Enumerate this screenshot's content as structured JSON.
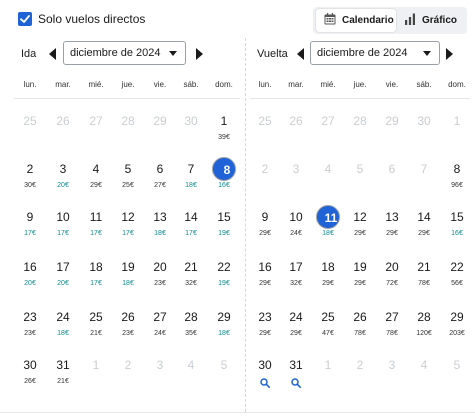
{
  "filters": {
    "direct_label": "Solo vuelos directos",
    "direct_checked": true
  },
  "view_toggle": {
    "calendar_label": "Calendario",
    "chart_label": "Gráfico",
    "active": "Calendario"
  },
  "outbound": {
    "label": "Ida",
    "month": "diciembre de 2024"
  },
  "return": {
    "label": "Vuelta",
    "month": "diciembre de 2024"
  },
  "weekdays": [
    "lun.",
    "mar.",
    "mié.",
    "jue.",
    "vie.",
    "sáb.",
    "dom."
  ],
  "outbound_weeks": [
    [
      {
        "d": "25",
        "out": true
      },
      {
        "d": "26",
        "out": true
      },
      {
        "d": "27",
        "out": true
      },
      {
        "d": "28",
        "out": true
      },
      {
        "d": "29",
        "out": true
      },
      {
        "d": "30",
        "out": true
      },
      {
        "d": "1",
        "p": "39€"
      }
    ],
    [
      {
        "d": "2",
        "p": "30€"
      },
      {
        "d": "3",
        "p": "20€",
        "g": true
      },
      {
        "d": "4",
        "p": "29€"
      },
      {
        "d": "5",
        "p": "25€"
      },
      {
        "d": "6",
        "p": "27€"
      },
      {
        "d": "7",
        "p": "18€",
        "g": true
      },
      {
        "d": "8",
        "p": "16€",
        "g": true,
        "sel": true
      }
    ],
    [
      {
        "d": "9",
        "p": "17€",
        "g": true
      },
      {
        "d": "10",
        "p": "17€",
        "g": true
      },
      {
        "d": "11",
        "p": "17€",
        "g": true
      },
      {
        "d": "12",
        "p": "17€",
        "g": true
      },
      {
        "d": "13",
        "p": "18€",
        "g": true
      },
      {
        "d": "14",
        "p": "17€",
        "g": true
      },
      {
        "d": "15",
        "p": "19€",
        "g": true
      }
    ],
    [
      {
        "d": "16",
        "p": "20€",
        "g": true
      },
      {
        "d": "17",
        "p": "20€",
        "g": true
      },
      {
        "d": "18",
        "p": "17€",
        "g": true
      },
      {
        "d": "19",
        "p": "18€",
        "g": true
      },
      {
        "d": "20",
        "p": "23€"
      },
      {
        "d": "21",
        "p": "32€"
      },
      {
        "d": "22",
        "p": "19€",
        "g": true
      }
    ],
    [
      {
        "d": "23",
        "p": "23€"
      },
      {
        "d": "24",
        "p": "18€",
        "g": true
      },
      {
        "d": "25",
        "p": "21€"
      },
      {
        "d": "26",
        "p": "23€"
      },
      {
        "d": "27",
        "p": "24€"
      },
      {
        "d": "28",
        "p": "35€"
      },
      {
        "d": "29",
        "p": "18€",
        "g": true
      }
    ],
    [
      {
        "d": "30",
        "p": "26€"
      },
      {
        "d": "31",
        "p": "21€"
      },
      {
        "d": "1",
        "out": true
      },
      {
        "d": "2",
        "out": true
      },
      {
        "d": "3",
        "out": true
      },
      {
        "d": "4",
        "out": true
      },
      {
        "d": "5",
        "out": true
      }
    ]
  ],
  "return_weeks": [
    [
      {
        "d": "25",
        "out": true
      },
      {
        "d": "26",
        "out": true
      },
      {
        "d": "27",
        "out": true
      },
      {
        "d": "28",
        "out": true
      },
      {
        "d": "29",
        "out": true
      },
      {
        "d": "30",
        "out": true
      },
      {
        "d": "1",
        "out": true
      }
    ],
    [
      {
        "d": "2",
        "out": true
      },
      {
        "d": "3",
        "out": true
      },
      {
        "d": "4",
        "out": true
      },
      {
        "d": "5",
        "out": true
      },
      {
        "d": "6",
        "out": true
      },
      {
        "d": "7",
        "out": true
      },
      {
        "d": "8",
        "p": "96€"
      }
    ],
    [
      {
        "d": "9",
        "p": "29€"
      },
      {
        "d": "10",
        "p": "24€"
      },
      {
        "d": "11",
        "p": "18€",
        "g": true,
        "sel": true
      },
      {
        "d": "12",
        "p": "29€"
      },
      {
        "d": "13",
        "p": "29€"
      },
      {
        "d": "14",
        "p": "29€"
      },
      {
        "d": "15",
        "p": "16€",
        "g": true
      }
    ],
    [
      {
        "d": "16",
        "p": "29€"
      },
      {
        "d": "17",
        "p": "32€"
      },
      {
        "d": "18",
        "p": "29€"
      },
      {
        "d": "19",
        "p": "29€"
      },
      {
        "d": "20",
        "p": "72€"
      },
      {
        "d": "21",
        "p": "78€"
      },
      {
        "d": "22",
        "p": "56€"
      }
    ],
    [
      {
        "d": "23",
        "p": "29€"
      },
      {
        "d": "24",
        "p": "29€"
      },
      {
        "d": "25",
        "p": "47€"
      },
      {
        "d": "26",
        "p": "78€"
      },
      {
        "d": "27",
        "p": "78€"
      },
      {
        "d": "28",
        "p": "120€"
      },
      {
        "d": "29",
        "p": "203€"
      }
    ],
    [
      {
        "d": "30",
        "search": true
      },
      {
        "d": "31",
        "search": true
      },
      {
        "d": "1",
        "out": true
      },
      {
        "d": "2",
        "out": true
      },
      {
        "d": "3",
        "out": true
      },
      {
        "d": "4",
        "out": true
      },
      {
        "d": "5",
        "out": true
      }
    ]
  ],
  "colors": {
    "accent": "#1f63d6",
    "cheap_price": "#0c8a8c",
    "muted_day": "#c9cdd2"
  },
  "icons": {
    "checkbox": "check-icon",
    "calendar": "calendar-icon",
    "chart": "bar-chart-icon",
    "prev": "triangle-left-icon",
    "next": "triangle-right-icon",
    "dropdown": "caret-down-icon",
    "search": "search-icon"
  }
}
